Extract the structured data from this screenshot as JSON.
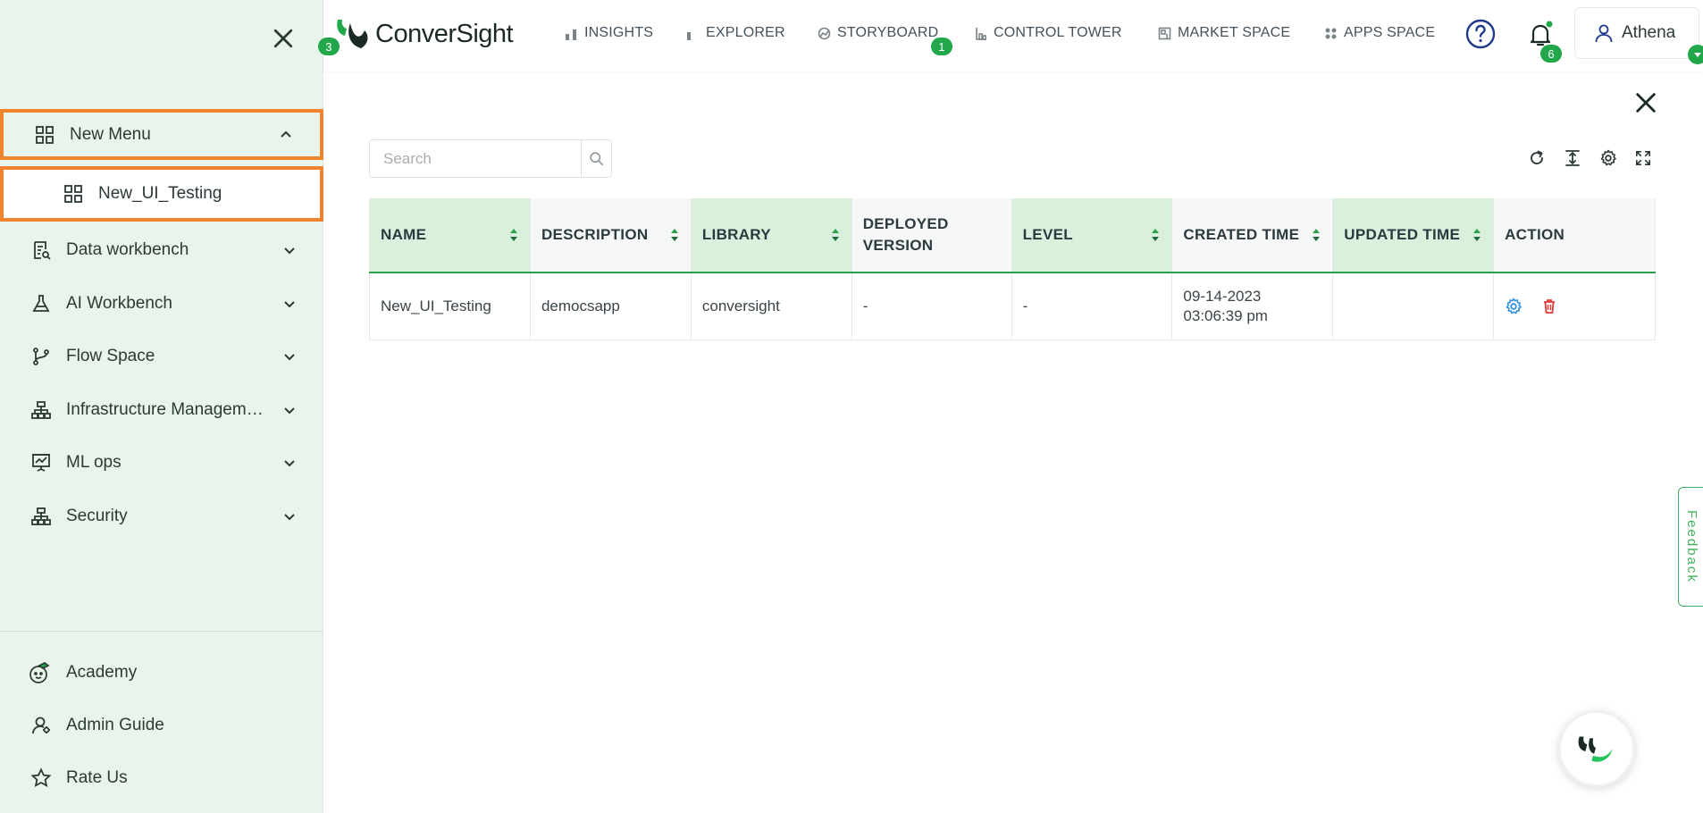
{
  "sidebar": {
    "items": [
      {
        "label": "New Menu",
        "icon": "grid-icon",
        "expanded": true
      },
      {
        "label": "New_UI_Testing",
        "icon": "grid-icon"
      },
      {
        "label": "Data workbench",
        "icon": "data-workbench-icon"
      },
      {
        "label": "AI Workbench",
        "icon": "flask-icon"
      },
      {
        "label": "Flow Space",
        "icon": "branch-icon"
      },
      {
        "label": "Infrastructure Management",
        "icon": "hierarchy-icon"
      },
      {
        "label": "ML ops",
        "icon": "presentation-chart-icon"
      },
      {
        "label": "Security",
        "icon": "hierarchy-icon"
      }
    ],
    "footer": [
      {
        "label": "Academy",
        "icon": "academy-icon"
      },
      {
        "label": "Admin Guide",
        "icon": "admin-guide-icon"
      },
      {
        "label": "Rate Us",
        "icon": "star-icon"
      }
    ]
  },
  "header": {
    "brand": "ConverSight",
    "nav": [
      {
        "label": "INSIGHTS",
        "badge": "3",
        "icon": "bar-chart-icon"
      },
      {
        "label": "EXPLORER",
        "icon": "bar-chart-icon"
      },
      {
        "label": "STORYBOARD",
        "badge": "1",
        "icon": "storyboard-icon"
      },
      {
        "label": "CONTROL TOWER",
        "icon": "tower-icon"
      },
      {
        "label": "MARKET SPACE",
        "icon": "market-icon"
      },
      {
        "label": "APPS SPACE",
        "icon": "apps-icon"
      }
    ],
    "notifications_count": "6",
    "user_name": "Athena"
  },
  "search": {
    "placeholder": "Search",
    "value": ""
  },
  "table": {
    "columns": [
      "NAME",
      "DESCRIPTION",
      "LIBRARY",
      "DEPLOYED VERSION",
      "LEVEL",
      "CREATED TIME",
      "UPDATED TIME",
      "ACTION"
    ],
    "rows": [
      {
        "name": "New_UI_Testing",
        "description": "democsapp",
        "library": "conversight",
        "deployed_version": "-",
        "level": "-",
        "created_date": "09-14-2023",
        "created_time": "03:06:39 pm",
        "updated_time": ""
      }
    ]
  },
  "feedback_label": "Feedback",
  "colors": {
    "accent": "#22a84a",
    "highlight": "#f0832e",
    "sidebar_bg": "#e9f5ea",
    "header_sort_bg": "#d8f0dc",
    "delete": "#e53935",
    "settings": "#2e8fe0"
  }
}
